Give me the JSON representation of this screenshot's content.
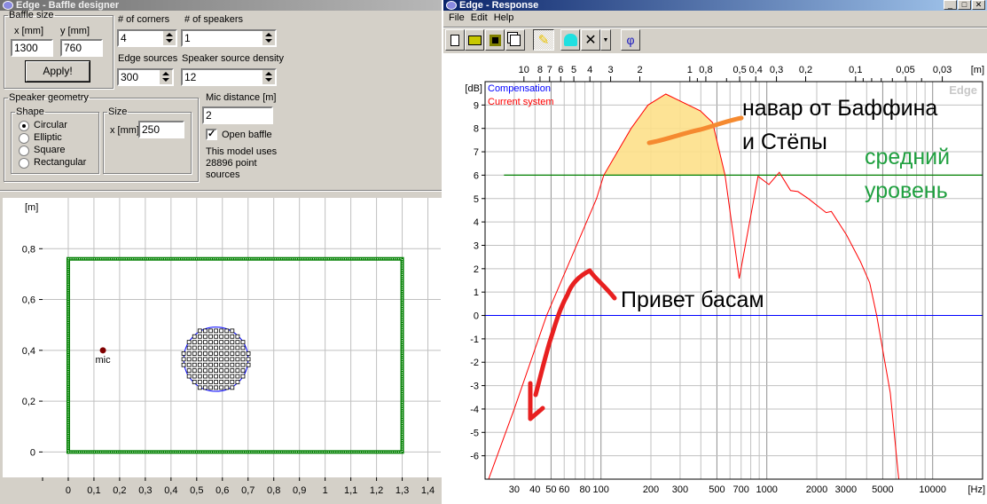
{
  "baffle_window": {
    "title": "Edge - Baffle designer",
    "baffle_size": {
      "legend": "Baffle size",
      "x_label": "x [mm]",
      "y_label": "y [mm]",
      "x_value": "1300",
      "y_value": "760",
      "apply_label": "Apply!"
    },
    "corners": {
      "label": "# of corners",
      "value": "4"
    },
    "speakers": {
      "label": "# of speakers",
      "value": "1"
    },
    "edge_sources": {
      "label": "Edge sources",
      "value": "300"
    },
    "speaker_density": {
      "label": "Speaker source density",
      "value": "12"
    },
    "geometry": {
      "legend": "Speaker geometry",
      "shape_legend": "Shape",
      "shapes": [
        {
          "label": "Circular",
          "selected": true
        },
        {
          "label": "Elliptic",
          "selected": false
        },
        {
          "label": "Square",
          "selected": false
        },
        {
          "label": "Rectangular",
          "selected": false
        }
      ],
      "size_legend": "Size",
      "size_label": "x [mm]",
      "size_value": "250"
    },
    "mic_distance": {
      "label": "Mic distance [m]",
      "value": "2"
    },
    "open_baffle": {
      "label": "Open baffle",
      "checked": true
    },
    "model_info": [
      "This model uses",
      "28896 point",
      "sources"
    ],
    "plot": {
      "unit": "[m]",
      "xlim": [
        -0.1,
        1.45
      ],
      "ylim": [
        -0.1,
        1.0
      ],
      "x_ticks": [
        "0",
        "0,1",
        "0,2",
        "0,3",
        "0,4",
        "0,5",
        "0,6",
        "0,7",
        "0,8",
        "0,9",
        "1",
        "1,1",
        "1,2",
        "1,3",
        "1,4"
      ],
      "y_ticks": [
        "0",
        "0,2",
        "0,4",
        "0,6",
        "0,8"
      ],
      "baffle_m": [
        1.3,
        0.76
      ],
      "speaker_center_m": [
        0.575,
        0.365
      ],
      "speaker_diameter_m": 0.25,
      "mic_m": [
        0.135,
        0.4
      ],
      "mic_label": "mic",
      "colors": {
        "baffle": "#008000",
        "speaker": "#0000ff",
        "mic": "#800000"
      }
    }
  },
  "response_window": {
    "title": "Edge - Response",
    "menu": [
      "File",
      "Edit",
      "Help"
    ],
    "toolbar": [
      "new-icon",
      "open-icon",
      "save-icon",
      "copy-icon",
      "pencil-icon",
      "bell-icon",
      "close-x-icon",
      "dropdown-arrow-icon",
      "phi-icon"
    ],
    "phi_label": "φ",
    "watermark": "Edge",
    "annotations": {
      "gain": [
        "навар от Баффина",
        "и Стёпы"
      ],
      "level": [
        "средний",
        "уровень"
      ],
      "bass": "Привет басам"
    }
  },
  "chart_data": {
    "type": "line",
    "xscale": "log",
    "xlim": [
      20,
      20000
    ],
    "ylim": [
      -7,
      10
    ],
    "xlabel": "[Hz]",
    "ylabel": "[dB]",
    "top_axis_label": "[m]",
    "x_ticks": [
      30,
      40,
      50,
      60,
      80,
      100,
      200,
      300,
      500,
      700,
      1000,
      2000,
      3000,
      5000,
      10000
    ],
    "y_ticks": [
      -6,
      -5,
      -4,
      -3,
      -2,
      -1,
      0,
      1,
      2,
      3,
      4,
      5,
      6,
      7,
      8,
      9
    ],
    "top_ticks_m": [
      "10",
      "8",
      "7",
      "6",
      "5",
      "4",
      "3",
      "2",
      "1",
      "0,8",
      "0,5",
      "0,4",
      "0,3",
      "0,2",
      "0,1",
      "0,05",
      "0,03"
    ],
    "grid": true,
    "legend_position": "top-left",
    "series": [
      {
        "name": "Compensation",
        "color": "#0000ff",
        "x": [
          20,
          20000
        ],
        "y": [
          0,
          0
        ]
      },
      {
        "name": "Current system",
        "color": "#ff0000",
        "x": [
          21,
          30,
          47,
          94,
          104,
          152,
          192,
          246,
          397,
          471,
          560,
          682,
          885,
          1030,
          1190,
          1390,
          1540,
          1780,
          2280,
          2450,
          3020,
          3670,
          4170,
          4600,
          5550,
          6250
        ],
        "y": [
          -7,
          -4,
          0,
          5,
          6,
          8,
          9,
          9.47,
          8.75,
          8.25,
          6,
          1.58,
          5.95,
          5.6,
          6.12,
          5.34,
          5.3,
          5.0,
          4.4,
          4.45,
          3.45,
          2.3,
          1.4,
          0,
          -3.3,
          -7
        ]
      }
    ],
    "average_level_db": 6,
    "average_level_color": "#008000",
    "highlight_fill": "#fde08a"
  }
}
